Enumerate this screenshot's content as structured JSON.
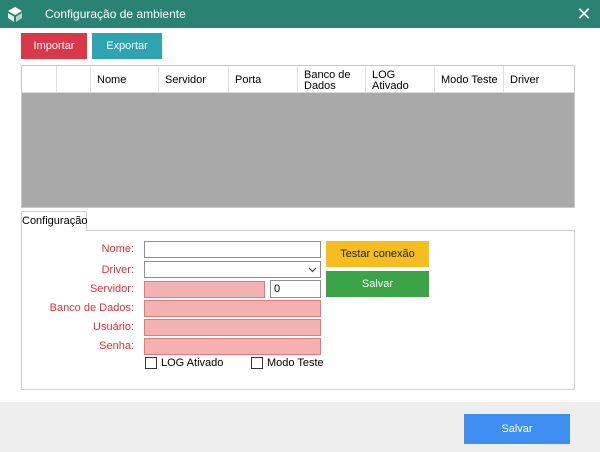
{
  "window": {
    "title": "Configuração de ambiente",
    "close_glyph": "✕"
  },
  "toolbar": {
    "import_label": "Importar",
    "export_label": "Exportar"
  },
  "grid": {
    "columns": [
      {
        "label": ""
      },
      {
        "label": ""
      },
      {
        "label": "Nome"
      },
      {
        "label": "Servidor"
      },
      {
        "label": "Porta"
      },
      {
        "label": "Banco de Dados"
      },
      {
        "label": "LOG Ativado"
      },
      {
        "label": "Modo Teste"
      },
      {
        "label": "Driver"
      }
    ]
  },
  "config": {
    "tab_label": "Configuração",
    "labels": {
      "nome": "Nome:",
      "driver": "Driver:",
      "servidor": "Servidor:",
      "banco": "Banco de Dados:",
      "usuario": "Usuário:",
      "senha": "Senha:"
    },
    "values": {
      "nome": "",
      "driver": "",
      "servidor": "",
      "porta": "0",
      "banco": "",
      "usuario": "",
      "senha": ""
    },
    "test_connection_label": "Testar conexão",
    "save_label": "Salvar",
    "log_label": "LOG Ativado",
    "log_checked": false,
    "test_mode_label": "Modo Teste",
    "test_mode_checked": false
  },
  "footer": {
    "save_label": "Salvar"
  },
  "colors": {
    "titlebar": "#2a8372",
    "import": "#d9374a",
    "export": "#2ea3b2",
    "test": "#f5be1e",
    "save_inner": "#3aa446",
    "save_main": "#3d8ef0",
    "invalid_field": "#f4b1b1",
    "label": "#e0303c"
  },
  "icons": {
    "app": "app-logo-icon",
    "close": "close-icon",
    "dropdown": "chevron-down-icon"
  }
}
